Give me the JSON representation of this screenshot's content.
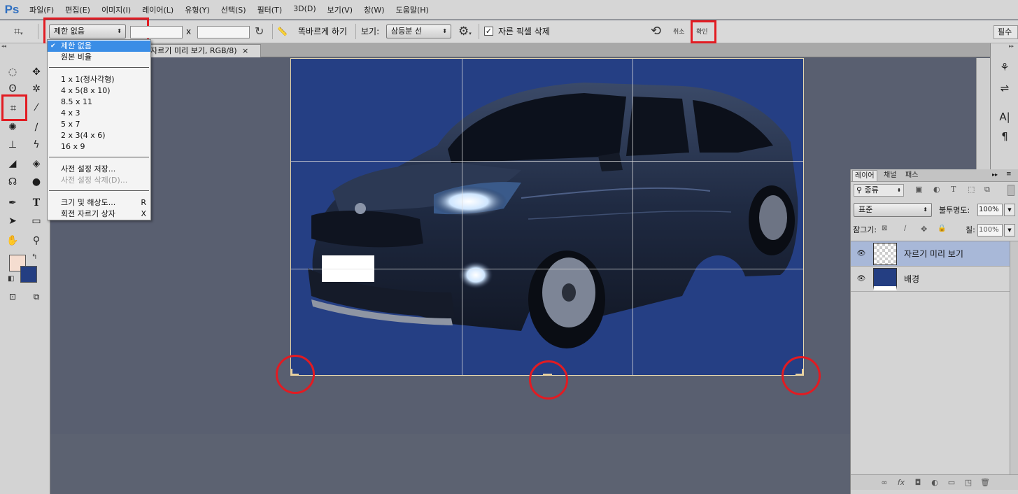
{
  "app": {
    "logo": "Ps"
  },
  "menu": [
    "파일(F)",
    "편집(E)",
    "이미지(I)",
    "레이어(L)",
    "유형(Y)",
    "선택(S)",
    "필터(T)",
    "3D(D)",
    "보기(V)",
    "창(W)",
    "도움말(H)"
  ],
  "options": {
    "ratio_select": "제한 없음",
    "width_value": "",
    "height_value": "",
    "times": "x",
    "straighten": "똑바르게 하기",
    "view_label": "보기:",
    "view_select": "삼등분 선",
    "delete_cropped_label": "자른 픽셀 삭제",
    "delete_cropped_checked": true,
    "cancel_label": "취소",
    "commit_label": "확인",
    "right_button": "필수"
  },
  "dropdown": {
    "items": [
      {
        "label": "제한 없음",
        "selected": true
      },
      {
        "label": "원본 비율"
      },
      {
        "sep": true
      },
      {
        "label": "1 x 1(정사각형)"
      },
      {
        "label": "4 x 5(8 x 10)"
      },
      {
        "label": "8.5 x 11"
      },
      {
        "label": "4 x 3"
      },
      {
        "label": "5 x 7"
      },
      {
        "label": "2 x 3(4 x 6)"
      },
      {
        "label": "16 x 9"
      },
      {
        "sep": true
      },
      {
        "label": "사전 설정 저장..."
      },
      {
        "label": "사전 설정 삭제(D)...",
        "disabled": true
      },
      {
        "sep": true
      },
      {
        "label": "크기 및 해상도...",
        "key": "R"
      },
      {
        "label": "회전 자르기 상자",
        "key": "X"
      }
    ]
  },
  "document": {
    "tab_title": "자르기 미리 보기, RGB/8)",
    "close": "×"
  },
  "layers_panel": {
    "tabs": [
      "레이어",
      "채널",
      "패스"
    ],
    "filter_label": "종류",
    "blend_mode": "표준",
    "opacity_label": "불투명도:",
    "opacity_value": "100%",
    "lock_label": "잠그기:",
    "fill_label": "칠:",
    "fill_value": "100%",
    "layers": [
      {
        "name": "자르기 미리 보기",
        "selected": true,
        "thumb": "checker"
      },
      {
        "name": "배경",
        "selected": false,
        "thumb": "navy"
      }
    ]
  },
  "colors": {
    "foreground": "#f5ddd0",
    "background": "#243e82",
    "canvas_bg": "#253f84",
    "workspace": "#595f70",
    "highlight": "#e21b22",
    "selection": "#3a8de6",
    "selected_layer": "#a8b8d8"
  }
}
